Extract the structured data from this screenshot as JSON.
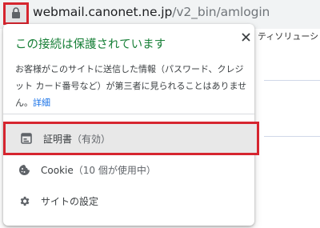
{
  "address_bar": {
    "url_host": "webmail.canonet.ne.jp",
    "url_path": "/v2_bin/amlogin",
    "lock_icon": "lock-icon"
  },
  "background_page": {
    "partial_text": "ティソリューショ..."
  },
  "popup": {
    "title": "この接続は保護されています",
    "description": "お客様がこのサイトに送信した情報（パスワード、クレジット カード番号など）が第三者に見られることはありません。",
    "details_link": "詳細",
    "close_icon": "close-icon",
    "items": [
      {
        "icon": "certificate-icon",
        "label": "証明書",
        "sub": "（有効）"
      },
      {
        "icon": "cookie-icon",
        "label": "Cookie",
        "sub": "（10 個が使用中）"
      },
      {
        "icon": "gear-icon",
        "label": "サイトの設定",
        "sub": ""
      }
    ]
  },
  "colors": {
    "secure_green": "#188038",
    "link_blue": "#1a73e8",
    "highlight_red": "#d6252f"
  }
}
